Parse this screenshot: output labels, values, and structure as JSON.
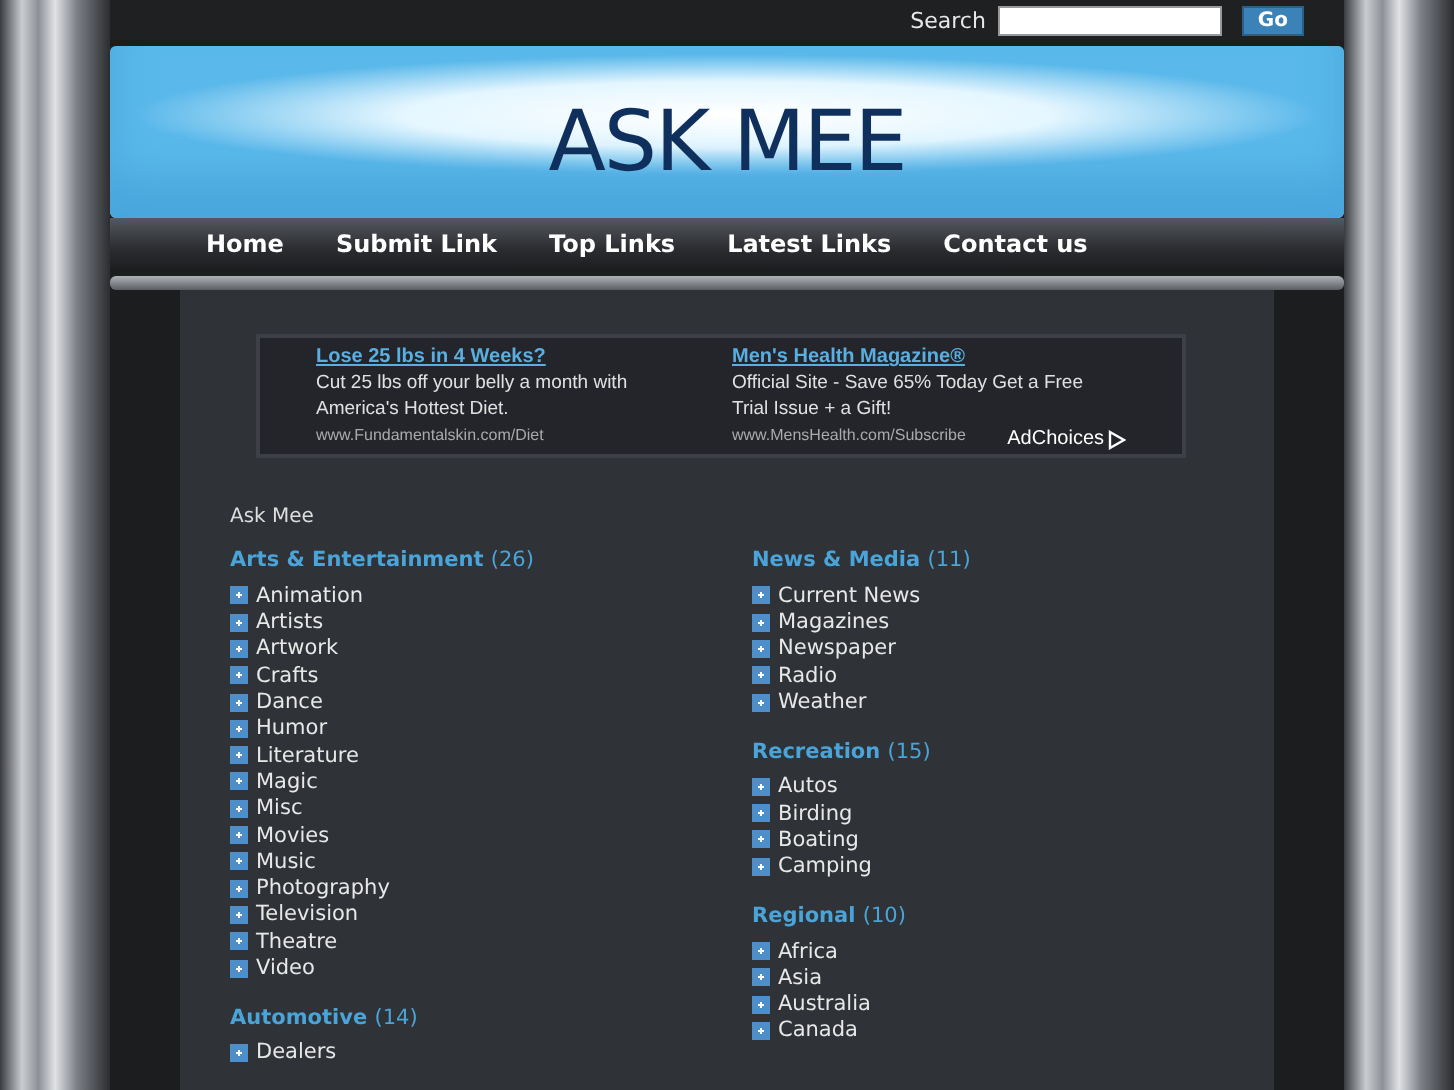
{
  "search": {
    "label": "Search",
    "button": "Go"
  },
  "site_title": "ASK MEE",
  "nav": [
    "Home",
    "Submit Link",
    "Top Links",
    "Latest Links",
    "Contact us"
  ],
  "ads": [
    {
      "title": "Lose 25 lbs in 4 Weeks?",
      "text": "Cut 25 lbs off your belly a month with America's Hottest Diet.",
      "url": "www.Fundamentalskin.com/Diet"
    },
    {
      "title": "Men's Health Magazine®",
      "text": "Official Site - Save 65% Today Get a Free Trial Issue + a Gift!",
      "url": "www.MensHealth.com/Subscribe"
    }
  ],
  "ad_choices": "AdChoices",
  "breadcrumb": "Ask Mee",
  "columns": [
    [
      {
        "name": "Arts & Entertainment",
        "count": "(26)",
        "items": [
          "Animation",
          "Artists",
          "Artwork",
          "Crafts",
          "Dance",
          "Humor",
          "Literature",
          "Magic",
          "Misc",
          "Movies",
          "Music",
          "Photography",
          "Television",
          "Theatre",
          "Video"
        ]
      },
      {
        "name": "Automotive",
        "count": "(14)",
        "items": [
          "Dealers"
        ]
      }
    ],
    [
      {
        "name": "News & Media",
        "count": "(11)",
        "items": [
          "Current News",
          "Magazines",
          "Newspaper",
          "Radio",
          "Weather"
        ]
      },
      {
        "name": "Recreation",
        "count": "(15)",
        "items": [
          "Autos",
          "Birding",
          "Boating",
          "Camping"
        ]
      },
      {
        "name": "Regional",
        "count": "(10)",
        "items": [
          "Africa",
          "Asia",
          "Australia",
          "Canada"
        ]
      }
    ]
  ]
}
